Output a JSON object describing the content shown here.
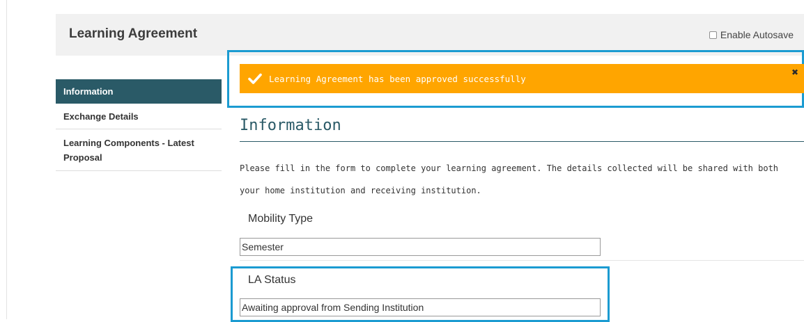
{
  "header": {
    "title": "Learning Agreement",
    "autosave_label": "Enable Autosave",
    "autosave_checked": false
  },
  "sidebar": {
    "items": [
      {
        "label": "Information",
        "active": true
      },
      {
        "label": "Exchange Details",
        "active": false
      },
      {
        "label": "Learning Components - Latest Proposal",
        "active": false
      }
    ]
  },
  "alert": {
    "message": "Learning Agreement has been approved successfully",
    "icon": "check-icon",
    "close_icon": "close-icon",
    "color": "#ffa500"
  },
  "main": {
    "section_title": "Information",
    "description": "Please fill in the form to complete your learning agreement. The details collected will be shared with both your home institution and receiving institution.",
    "fields": [
      {
        "label": "Mobility Type",
        "value": "Semester"
      },
      {
        "label": "LA Status",
        "value": "Awaiting approval from Sending Institution"
      }
    ]
  },
  "colors": {
    "accent": "#2a5a67",
    "highlight": "#1b9bd1",
    "alert": "#ffa500"
  }
}
